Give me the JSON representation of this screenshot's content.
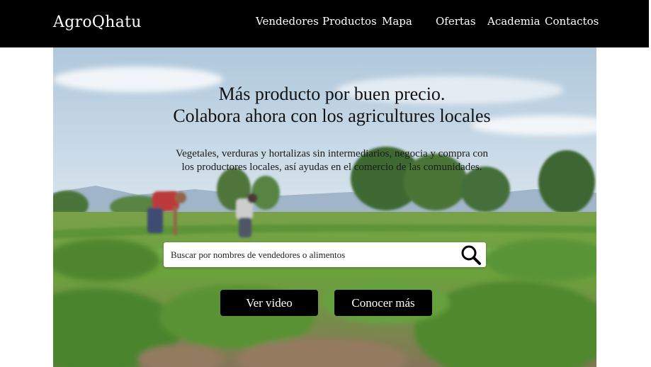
{
  "navbar": {
    "brand": "AgroQhatu",
    "items": [
      {
        "label": "Vendedores"
      },
      {
        "label": "Productos"
      },
      {
        "label": "Mapa"
      },
      {
        "label": "Ofertas"
      },
      {
        "label": "Academia"
      },
      {
        "label": "Contactos"
      }
    ]
  },
  "hero": {
    "headline_line1": "Más producto por buen precio.",
    "headline_line2": "Colabora ahora con los agricultures locales",
    "subtext_line1": "Vegetales, verduras y hortalizas sin intermediarios, negocia y compra con",
    "subtext_line2": "los productores locales, así ayudas en el comercio de las comunidades.",
    "search": {
      "placeholder": "Buscar por nombres de vendedores o alimentos",
      "icon": "search-icon"
    },
    "buttons": {
      "video_label": "Ver video",
      "more_label": "Conocer más"
    }
  },
  "colors": {
    "navbar_bg": "#000000",
    "button_bg": "#000000",
    "text_light": "#ffffff",
    "text_dark": "#111111"
  }
}
